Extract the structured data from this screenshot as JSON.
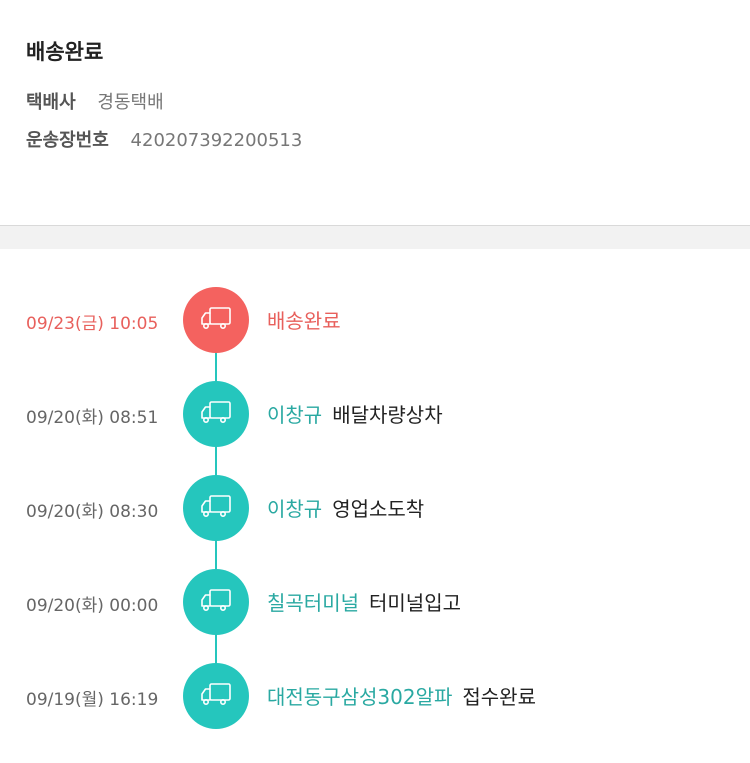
{
  "summary": {
    "status": "배송완료",
    "courier_label": "택배사",
    "courier_value": "경동택배",
    "invoice_label": "운송장번호",
    "invoice_value": "420207392200513"
  },
  "colors": {
    "accent_teal": "#25c6bd",
    "current_red": "#f4625f"
  },
  "timeline": {
    "icon": "truck-icon",
    "events": [
      {
        "datetime": "09/23(금) 10:05",
        "location": "",
        "message": "배송완료",
        "current": true
      },
      {
        "datetime": "09/20(화) 08:51",
        "location": "이창규",
        "message": "배달차량상차",
        "current": false
      },
      {
        "datetime": "09/20(화) 08:30",
        "location": "이창규",
        "message": "영업소도착",
        "current": false
      },
      {
        "datetime": "09/20(화) 00:00",
        "location": "칠곡터미널",
        "message": "터미널입고",
        "current": false
      },
      {
        "datetime": "09/19(월) 16:19",
        "location": "대전동구삼성302알파",
        "message": "접수완료",
        "current": false
      }
    ]
  }
}
